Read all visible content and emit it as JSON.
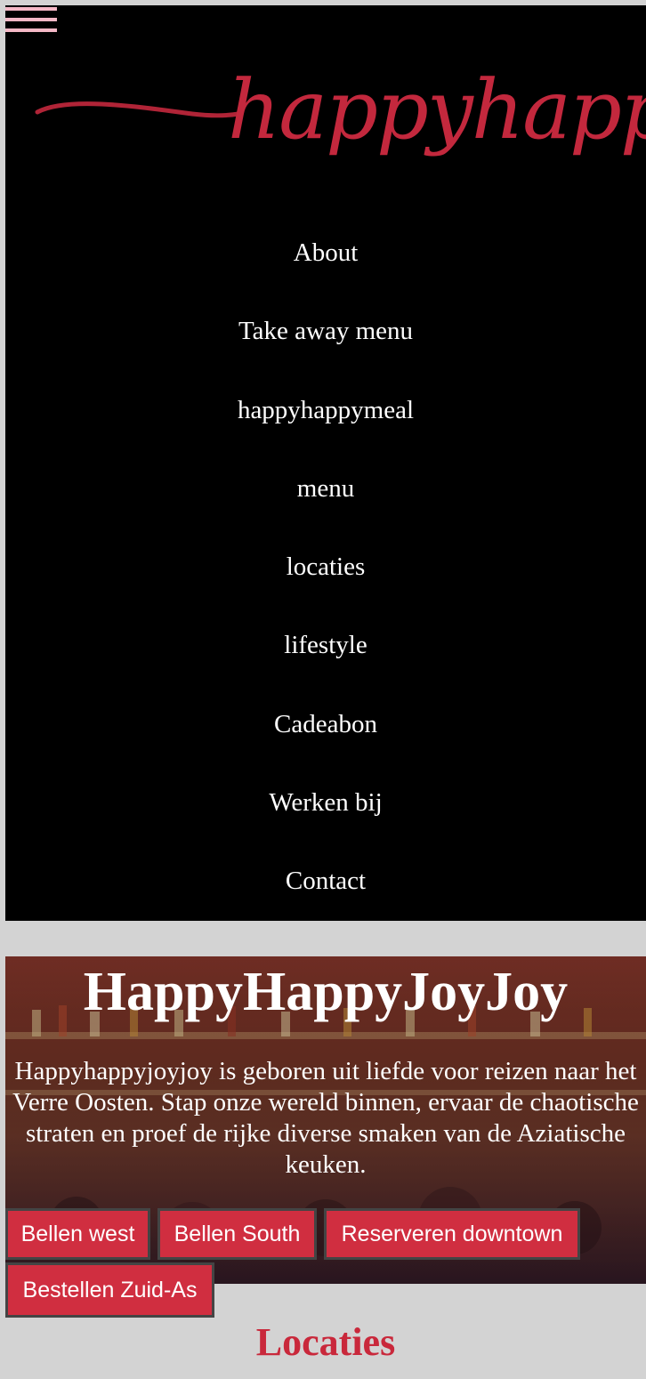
{
  "logo": {
    "text": "happyhappyjoyjoy",
    "color": "#c3283d"
  },
  "nav": {
    "items": [
      {
        "label": "About"
      },
      {
        "label": "Take away menu"
      },
      {
        "label": "happyhappymeal"
      },
      {
        "label": "menu"
      },
      {
        "label": "locaties"
      },
      {
        "label": "lifestyle"
      },
      {
        "label": "Cadeabon"
      },
      {
        "label": "Werken bij"
      },
      {
        "label": "Contact"
      }
    ]
  },
  "hero": {
    "title": "HappyHappyJoyJoy",
    "text": "Happyhappyjoyjoy is geboren uit liefde voor reizen naar het Verre Oosten. Stap onze wereld binnen, ervaar de chaotische straten en proef de rijke diverse smaken van de Aziatische keuken.",
    "buttons": [
      {
        "label": "Bellen west"
      },
      {
        "label": "Bellen South"
      },
      {
        "label": "Reserveren downtown"
      },
      {
        "label": "Bestellen Zuid-As"
      }
    ]
  },
  "locaties": {
    "title": "Locaties"
  },
  "colors": {
    "accent": "#d02e40",
    "hamburger": "#f4b8c6",
    "nav_bg": "#000000",
    "page_bg": "#d3d3d3"
  }
}
